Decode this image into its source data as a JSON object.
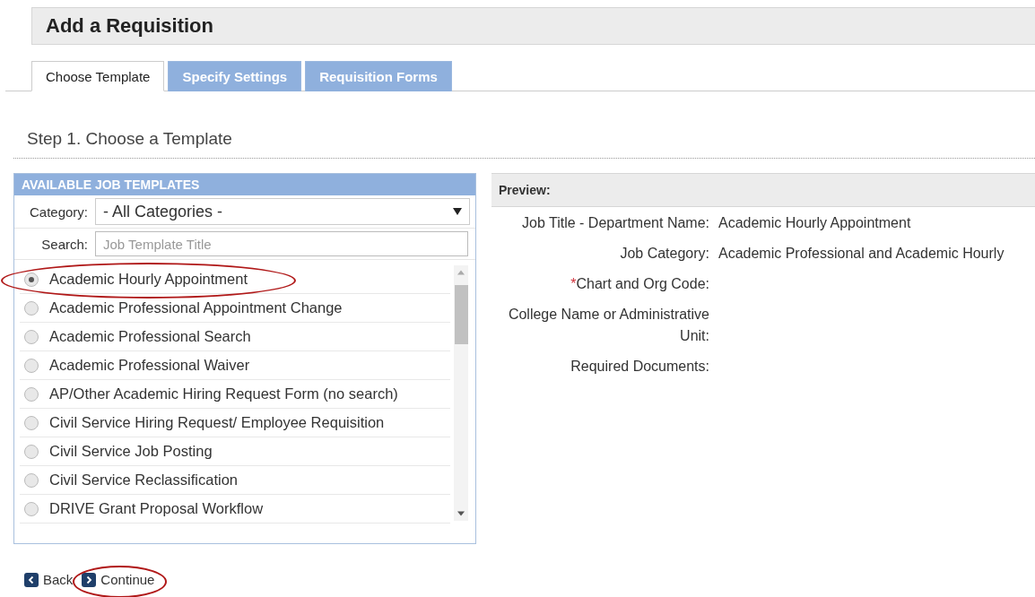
{
  "page_title": "Add a Requisition",
  "tabs": [
    {
      "label": "Choose Template",
      "selected": true
    },
    {
      "label": "Specify Settings",
      "selected": false
    },
    {
      "label": "Requisition Forms",
      "selected": false
    }
  ],
  "step_heading": "Step 1. Choose a Template",
  "templates_panel": {
    "title": "AVAILABLE JOB TEMPLATES",
    "category_label": "Category:",
    "category_value": "- All Categories -",
    "search_label": "Search:",
    "search_placeholder": "Job Template Title",
    "items": [
      {
        "label": "Academic Hourly Appointment",
        "selected": true,
        "circled": true
      },
      {
        "label": "Academic Professional Appointment Change",
        "selected": false,
        "circled": false
      },
      {
        "label": "Academic Professional Search",
        "selected": false,
        "circled": false
      },
      {
        "label": "Academic Professional Waiver",
        "selected": false,
        "circled": false
      },
      {
        "label": "AP/Other Academic Hiring Request Form (no search)",
        "selected": false,
        "circled": false
      },
      {
        "label": "Civil Service Hiring Request/ Employee Requisition",
        "selected": false,
        "circled": false
      },
      {
        "label": "Civil Service Job Posting",
        "selected": false,
        "circled": false
      },
      {
        "label": "Civil Service Reclassification",
        "selected": false,
        "circled": false
      },
      {
        "label": "DRIVE Grant Proposal Workflow",
        "selected": false,
        "circled": false
      }
    ]
  },
  "preview": {
    "title": "Preview:",
    "fields": [
      {
        "label": "Job Title - Department Name:",
        "value": "Academic Hourly Appointment"
      },
      {
        "label": "Job Category:",
        "value": "Academic Professional and Academic Hourly"
      },
      {
        "marker": "*",
        "label": "Chart and Org Code:"
      },
      {
        "label": "College Name or Administrative Unit:"
      },
      {
        "label": "Required Documents:"
      }
    ]
  },
  "buttons": [
    {
      "label": "Back",
      "kind": "back",
      "circled": false
    },
    {
      "label": "Continue",
      "kind": "continue",
      "circled": true
    }
  ]
}
